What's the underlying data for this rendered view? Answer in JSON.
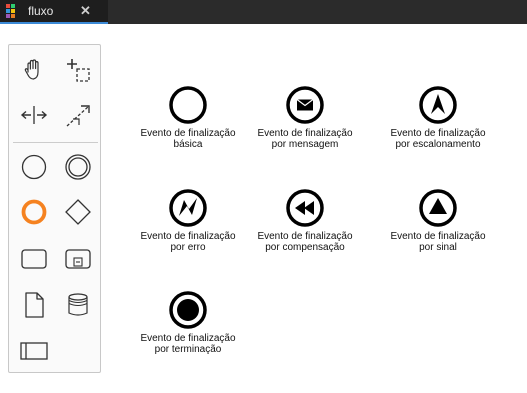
{
  "tab": {
    "title": "fluxo",
    "close_label": "✕"
  },
  "palette": {
    "tools": [
      {
        "name": "hand-tool",
        "icon": "hand-icon"
      },
      {
        "name": "lasso-tool",
        "icon": "lasso-icon"
      },
      {
        "name": "space-tool",
        "icon": "space-icon"
      },
      {
        "name": "connect-tool",
        "icon": "connect-icon"
      },
      {
        "name": "start-event",
        "icon": "circle-thin-icon"
      },
      {
        "name": "intermediate-event",
        "icon": "circle-double-icon"
      },
      {
        "name": "end-event",
        "icon": "circle-thick-icon"
      },
      {
        "name": "gateway",
        "icon": "diamond-icon"
      },
      {
        "name": "task",
        "icon": "rounded-rect-icon"
      },
      {
        "name": "subprocess",
        "icon": "subprocess-icon"
      },
      {
        "name": "data-object",
        "icon": "document-icon"
      },
      {
        "name": "data-store",
        "icon": "database-icon"
      },
      {
        "name": "pool",
        "icon": "pool-icon"
      }
    ],
    "accent_color": "#f58220"
  },
  "events": [
    {
      "label": "Evento de finalização básica",
      "icon": "end-event-none-icon"
    },
    {
      "label": "Evento de finalização por mensagem",
      "icon": "end-event-message-icon"
    },
    {
      "label": "Evento de finalização por escalonamento",
      "icon": "end-event-escalation-icon"
    },
    {
      "label": "Evento de finalização por erro",
      "icon": "end-event-error-icon"
    },
    {
      "label": "Evento de finalização por compensação",
      "icon": "end-event-compensation-icon"
    },
    {
      "label": "Evento de finalização por sinal",
      "icon": "end-event-signal-icon"
    },
    {
      "label": "Evento de finalização por terminação",
      "icon": "end-event-terminate-icon"
    }
  ]
}
